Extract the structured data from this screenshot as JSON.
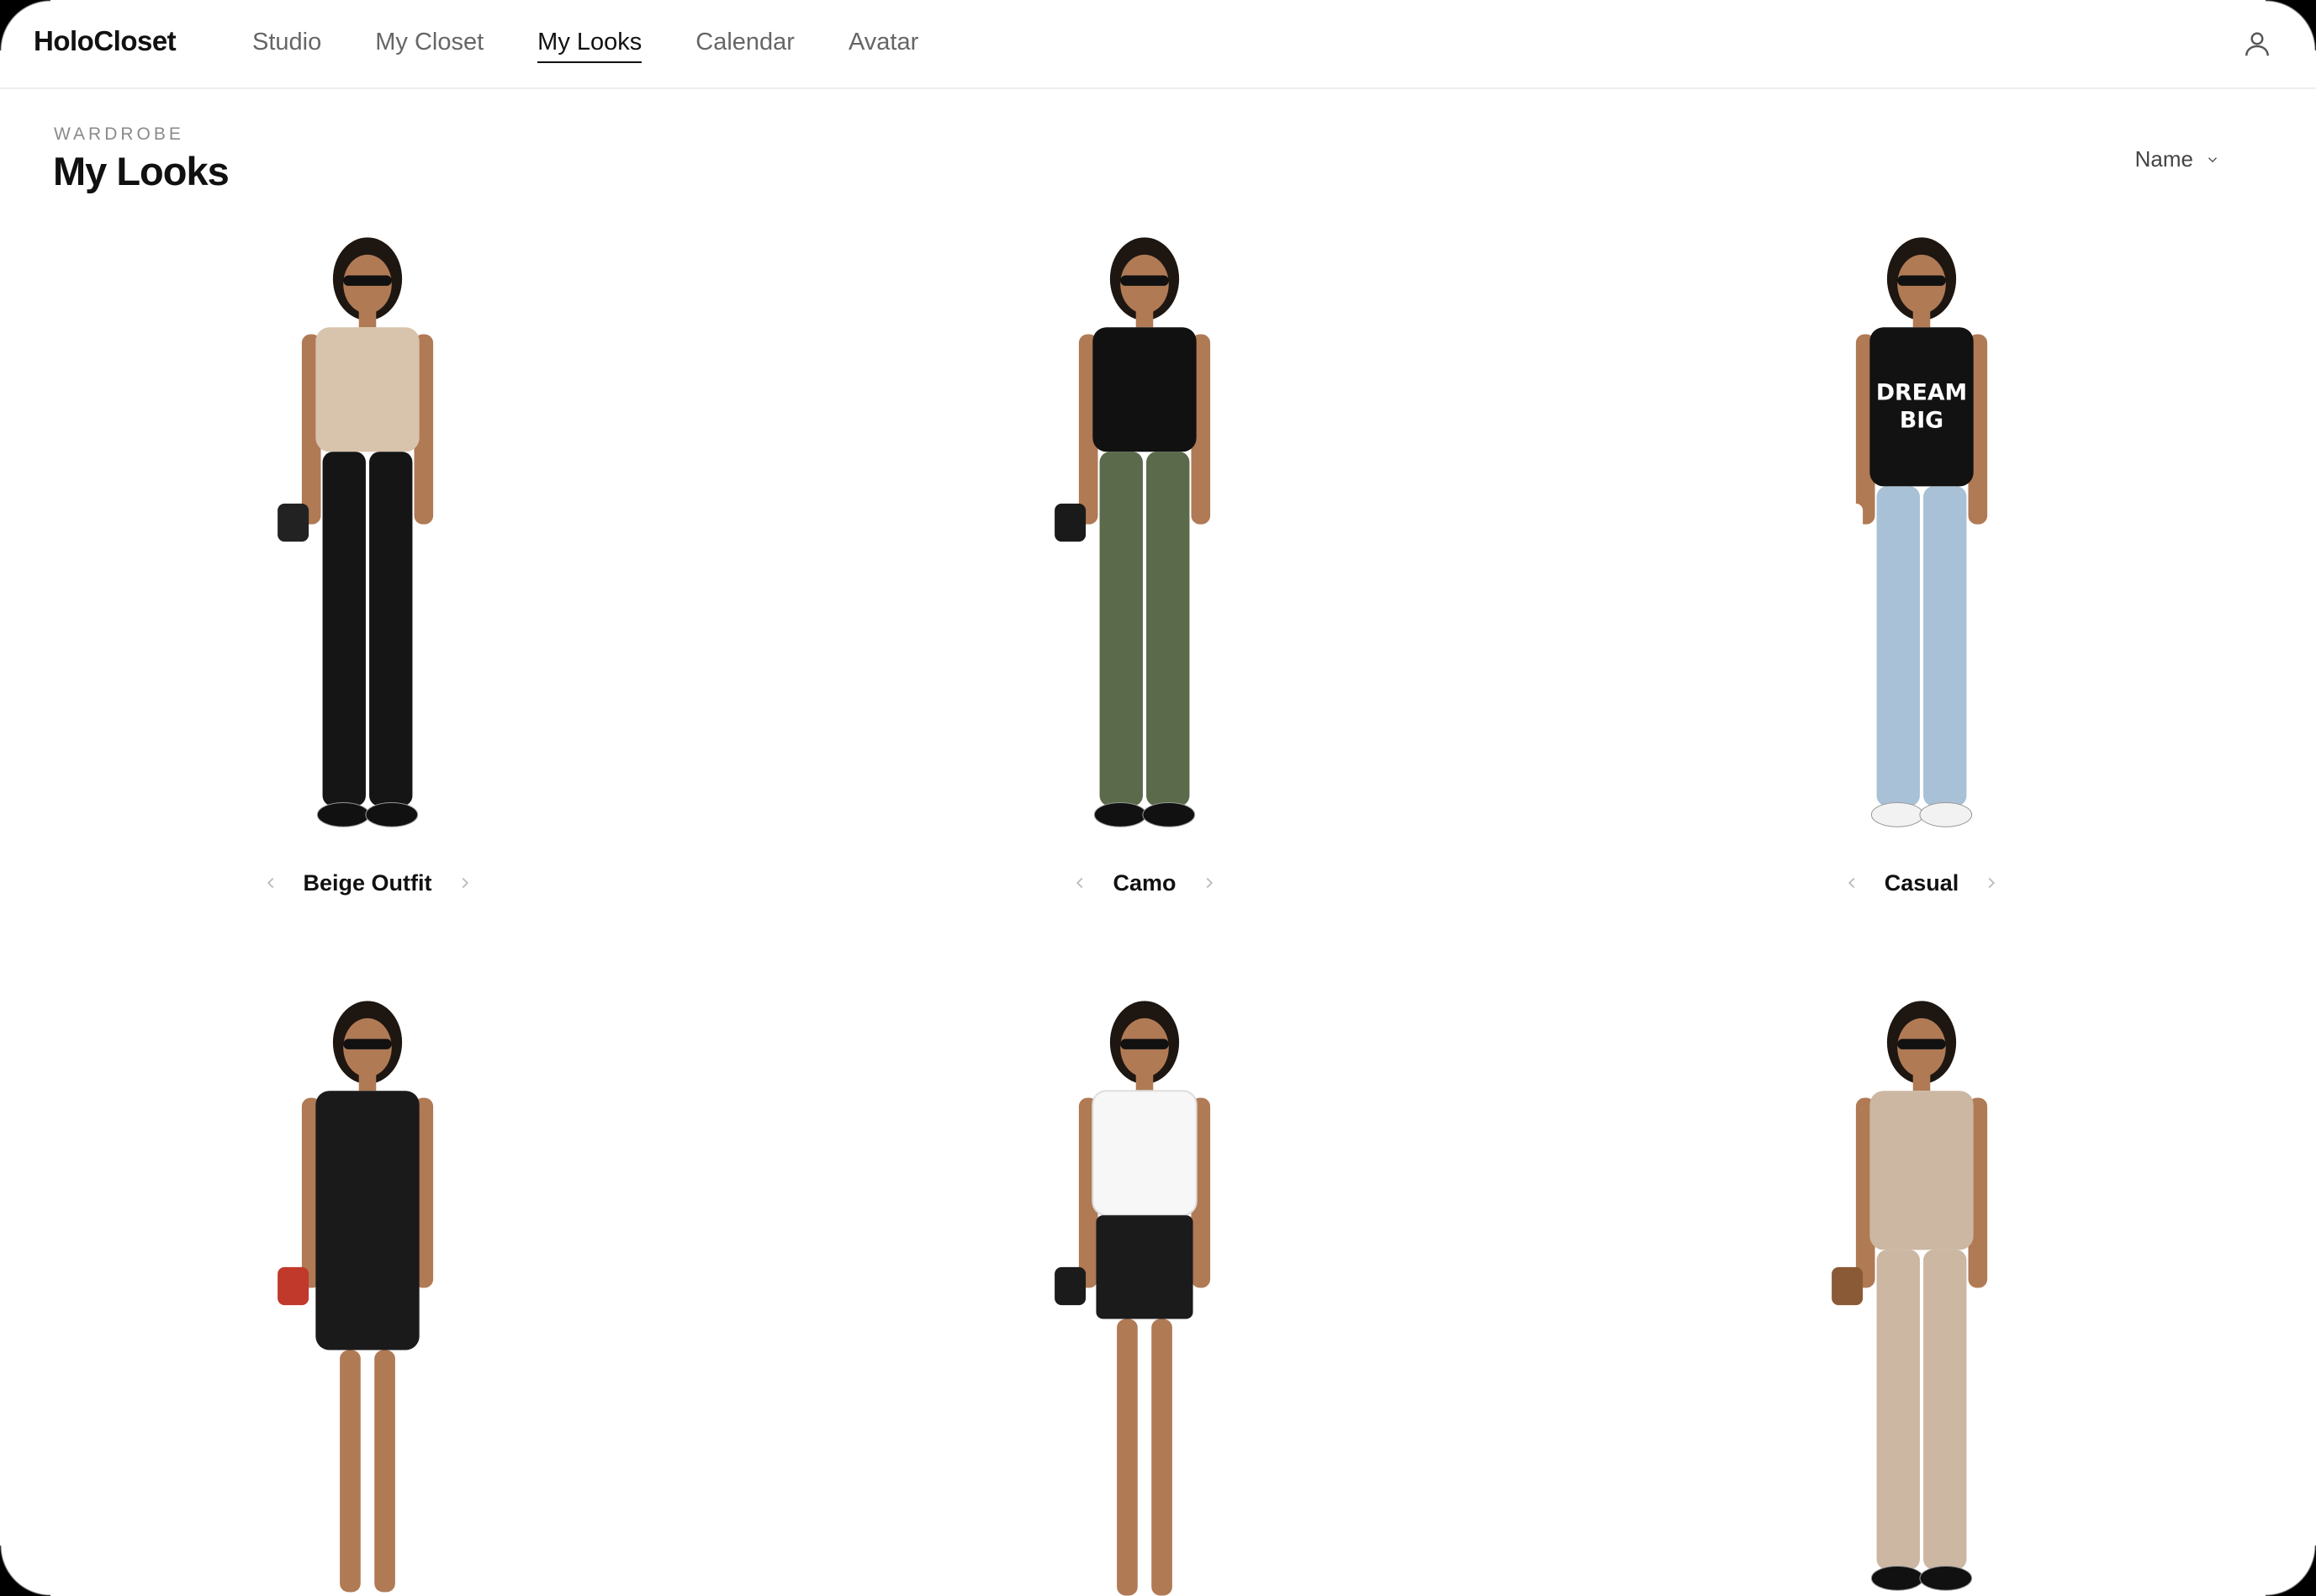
{
  "app": {
    "brand": "HoloCloset"
  },
  "nav": {
    "items": [
      {
        "label": "Studio"
      },
      {
        "label": "My Closet"
      },
      {
        "label": "My Looks",
        "active": true
      },
      {
        "label": "Calendar"
      },
      {
        "label": "Avatar"
      }
    ]
  },
  "header": {
    "eyebrow": "WARDROBE",
    "title": "My Looks"
  },
  "sort": {
    "label": "Name",
    "icon": "chevron-down-icon"
  },
  "looks": [
    {
      "name": "Beige Outfit",
      "top": "#d8c3ad",
      "bottom": "#151515",
      "accent": "#222222"
    },
    {
      "name": "Camo",
      "top": "#111111",
      "bottom": "#5b6a4a",
      "accent": "#1a1a1a"
    },
    {
      "name": "Casual",
      "top": "#121212",
      "bottom": "#a9c1d6",
      "accent": "#ffffff",
      "print": "DREAM BIG"
    },
    {
      "name": "",
      "top": "#1a1a1a",
      "bottom": "#1a1a1a",
      "accent": "#c0392b"
    },
    {
      "name": "",
      "top": "#f7f7f7",
      "bottom": "#1b1b1b",
      "accent": "#1b1b1b"
    },
    {
      "name": "",
      "top": "#cbb7a2",
      "bottom": "#cbb7a2",
      "accent": "#8a5a36"
    }
  ],
  "colors": {
    "text": "#111111",
    "muted": "#666666",
    "divider": "#eeeeee",
    "skin": "#b07a55",
    "hair": "#1e1611"
  }
}
